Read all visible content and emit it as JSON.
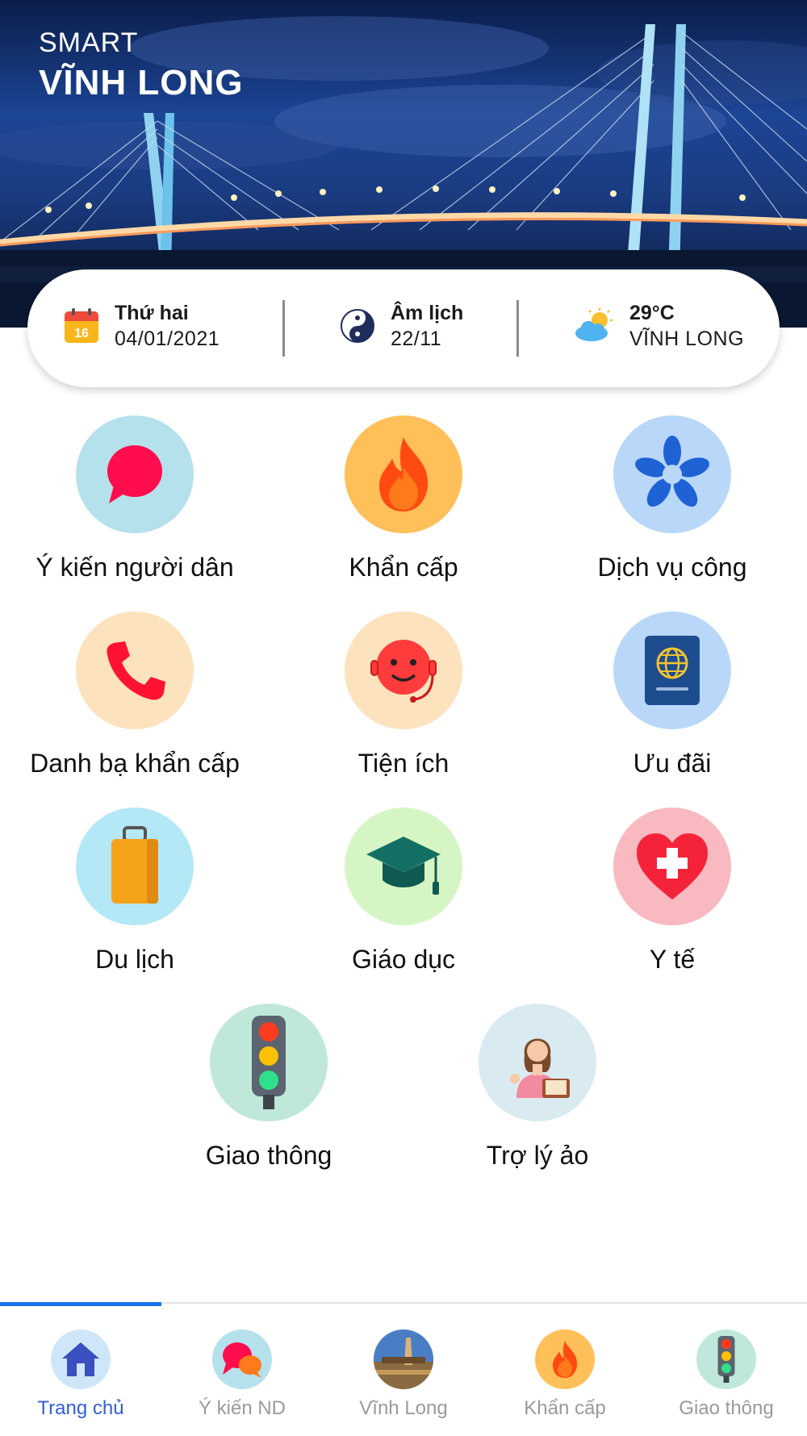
{
  "header": {
    "brand_top": "SMART",
    "brand_main": "VĨNH LONG"
  },
  "info": {
    "date_label": "Thứ hai",
    "date_value": "04/01/2021",
    "calendar_day": "16",
    "lunar_label": "Âm lịch",
    "lunar_value": "22/11",
    "weather_temp": "29°C",
    "weather_place": "VĨNH LONG"
  },
  "grid": [
    {
      "label": "Ý kiến người dân",
      "icon": "speech-bubble-icon",
      "bg": "#b5e1ec"
    },
    {
      "label": "Khẩn cấp",
      "icon": "fire-icon",
      "bg": "#ffbf59"
    },
    {
      "label": "Dịch vụ công",
      "icon": "hands-star-icon",
      "bg": "#b9d7f8"
    },
    {
      "label": "Danh bạ khẩn cấp",
      "icon": "phone-icon",
      "bg": "#fde2be"
    },
    {
      "label": "Tiện ích",
      "icon": "support-agent-icon",
      "bg": "#fde2be"
    },
    {
      "label": "Ưu đãi",
      "icon": "passport-icon",
      "bg": "#b9d7f8"
    },
    {
      "label": "Du lịch",
      "icon": "luggage-icon",
      "bg": "#b4e8f7"
    },
    {
      "label": "Giáo dục",
      "icon": "graduation-cap-icon",
      "bg": "#d6f5c4"
    },
    {
      "label": "Y tế",
      "icon": "heart-cross-icon",
      "bg": "#f9b9c0"
    },
    {
      "label": "Giao thông",
      "icon": "traffic-light-icon",
      "bg": "#bfe8da"
    },
    {
      "label": "Trợ lý ảo",
      "icon": "virtual-assistant-icon",
      "bg": "#d9ebf0"
    }
  ],
  "nav": [
    {
      "label": "Trang chủ",
      "icon": "home-icon",
      "active": true
    },
    {
      "label": "Ý kiến ND",
      "icon": "chat-bubbles-icon",
      "active": false
    },
    {
      "label": "Vĩnh Long",
      "icon": "city-photo-icon",
      "active": false
    },
    {
      "label": "Khẩn cấp",
      "icon": "fire-icon",
      "active": false
    },
    {
      "label": "Giao thông",
      "icon": "traffic-light-icon",
      "active": false
    }
  ],
  "colors": {
    "accent": "#2f5fd6",
    "indicator": "#1a73e8",
    "inactive": "#9a9a9a"
  }
}
